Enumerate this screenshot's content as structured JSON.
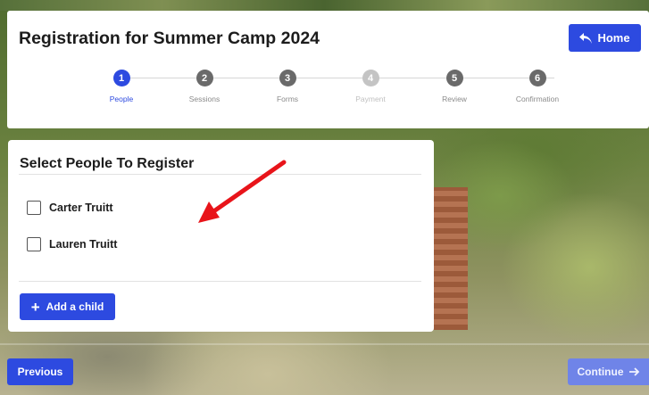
{
  "header": {
    "title": "Registration for Summer Camp 2024",
    "home_label": "Home"
  },
  "stepper": {
    "steps": [
      {
        "number": "1",
        "label": "People",
        "state": "active"
      },
      {
        "number": "2",
        "label": "Sessions",
        "state": "pending"
      },
      {
        "number": "3",
        "label": "Forms",
        "state": "pending"
      },
      {
        "number": "4",
        "label": "Payment",
        "state": "disabled"
      },
      {
        "number": "5",
        "label": "Review",
        "state": "pending"
      },
      {
        "number": "6",
        "label": "Confirmation",
        "state": "pending"
      }
    ]
  },
  "people_card": {
    "title": "Select People To Register",
    "people": [
      {
        "name": "Carter Truitt",
        "checked": false
      },
      {
        "name": "Lauren Truitt",
        "checked": false
      }
    ],
    "add_child_label": "Add a child"
  },
  "nav": {
    "previous_label": "Previous",
    "continue_label": "Continue"
  },
  "colors": {
    "primary": "#2d4ae0",
    "primary_disabled": "#6f84e8",
    "step_pending": "#6a6a6a",
    "step_disabled": "#c4c4c4",
    "annotation_arrow": "#e8141a"
  },
  "icons": {
    "home_button": "reply-arrow-icon",
    "add_child": "plus-icon",
    "continue": "arrow-right-icon"
  }
}
